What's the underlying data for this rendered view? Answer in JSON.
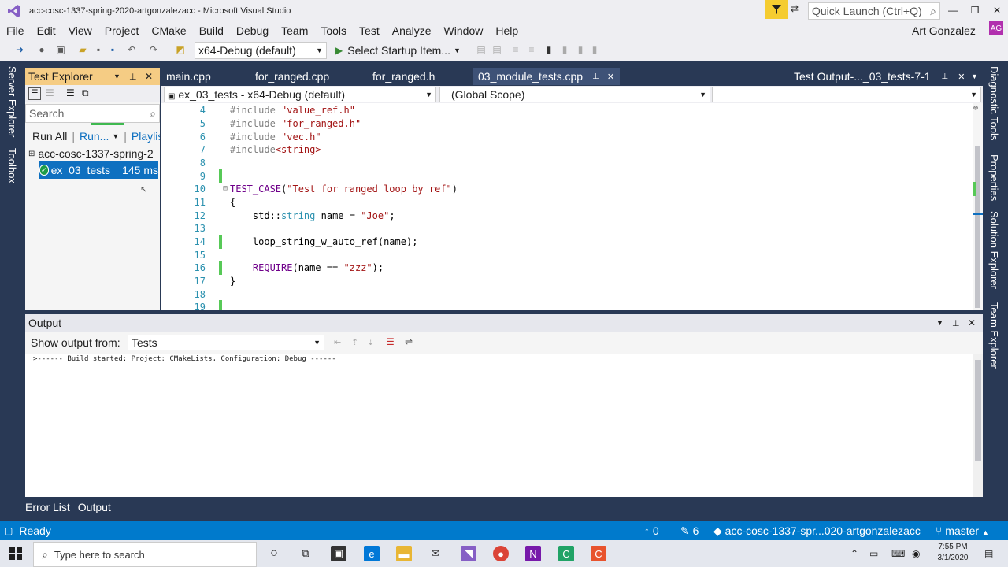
{
  "window": {
    "title": "acc-cosc-1337-spring-2020-artgonzalezacc - Microsoft Visual Studio"
  },
  "quick_launch": {
    "placeholder": "Quick Launch (Ctrl+Q)"
  },
  "menu": [
    "File",
    "Edit",
    "View",
    "Project",
    "CMake",
    "Build",
    "Debug",
    "Team",
    "Tools",
    "Test",
    "Analyze",
    "Window",
    "Help"
  ],
  "user": {
    "name": "Art Gonzalez",
    "initials": "AG"
  },
  "toolbar": {
    "config": "x64-Debug (default)",
    "startup": "Select Startup Item..."
  },
  "side_left": [
    "Server Explorer",
    "Toolbox"
  ],
  "side_right": [
    "Diagnostic Tools",
    "Properties",
    "Solution Explorer",
    "Team Explorer"
  ],
  "test_explorer": {
    "title": "Test Explorer",
    "search_placeholder": "Search",
    "run_all": "Run All",
    "run": "Run...",
    "playlist": "Playlis",
    "project": "acc-cosc-1337-spring-2",
    "test_name": "ex_03_tests",
    "test_time": "145 ms"
  },
  "tabs": [
    "main.cpp",
    "for_ranged.cpp",
    "for_ranged.h",
    "03_module_tests.cpp"
  ],
  "output_tab": "Test Output-..._03_tests-7-1",
  "nav": {
    "project": "ex_03_tests - x64-Debug (default)",
    "scope": "(Global Scope)"
  },
  "code": {
    "line_numbers": [
      "4",
      "5",
      "6",
      "7",
      "8",
      "9",
      "10",
      "11",
      "12",
      "13",
      "14",
      "15",
      "16",
      "17",
      "18",
      "19"
    ],
    "l4_inc": "#include",
    "l4_str": "\"value_ref.h\"",
    "l5_inc": "#include",
    "l5_str": "\"for_ranged.h\"",
    "l6_inc": "#include",
    "l6_str": "\"vec.h\"",
    "l7_inc": "#include",
    "l7_str": "<string>",
    "l10_mac": "TEST_CASE",
    "l10_open": "(",
    "l10_str": "\"Test for ranged loop by ref\"",
    "l10_close": ")",
    "l11": "{",
    "l12_a": "    std::",
    "l12_type": "string",
    "l12_b": " name = ",
    "l12_str": "\"Joe\"",
    "l12_c": ";",
    "l14": "    loop_string_w_auto_ref(name);",
    "l16_mac": "    REQUIRE",
    "l16_a": "(name == ",
    "l16_str": "\"zzz\"",
    "l16_b": ");",
    "l17": "}"
  },
  "output": {
    "title": "Output",
    "show_from_label": "Show output from:",
    "source": "Tests",
    "text": ">------ Build started: Project: CMakeLists, Configuration: Debug ------"
  },
  "bottom_tabs": [
    "Error List",
    "Output"
  ],
  "status": {
    "ready": "Ready",
    "up": "0",
    "pencil": "6",
    "repo": "acc-cosc-1337-spr...020-artgonzalezacc",
    "branch": "master"
  },
  "taskbar": {
    "search": "Type here to search",
    "time": "7:55 PM",
    "date": "3/1/2020"
  },
  "colors": {
    "accent": "#007acc",
    "chrome": "#eeeef2",
    "frame": "#293955",
    "te_header": "#f5cc84",
    "selection": "#0e70c0"
  }
}
